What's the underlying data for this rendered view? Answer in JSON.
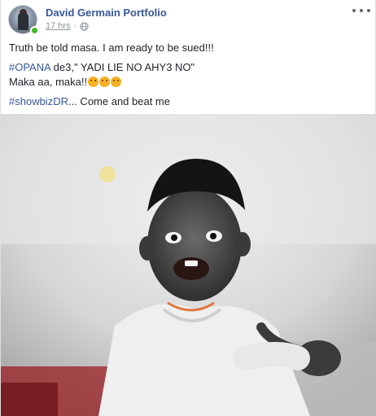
{
  "post": {
    "author": "David Germain Portfolio",
    "timestamp": "17 hrs",
    "separator": "·",
    "privacy_icon": "globe-icon",
    "more_icon": "more-options-icon",
    "lines": {
      "line1": "Truth be told masa. I am ready to be sued!!!",
      "line2_tag": "#OPANA",
      "line2_text": " de3,\" YADI LIE NO AHY3 NO\"",
      "line3_text": "Maka aa, maka!!",
      "line4_tag": "#showbizDR",
      "line4_text": "... Come and beat me"
    },
    "colors": {
      "link": "#385898",
      "online": "#42b72a"
    }
  }
}
